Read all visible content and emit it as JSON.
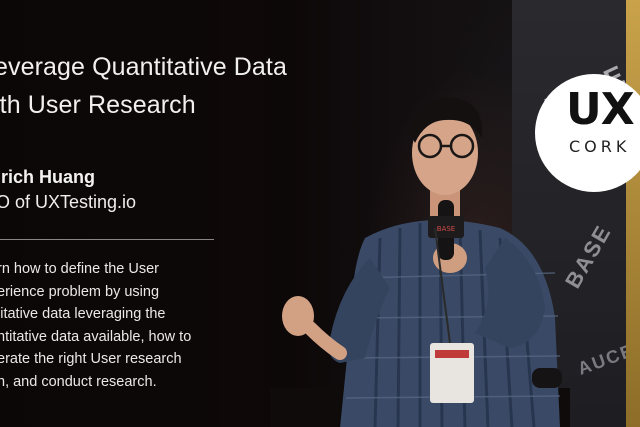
{
  "slide": {
    "title": "everage Quantitative Data\nith User Research",
    "speaker_name": "lrich Huang",
    "speaker_role": "O of UXTesting.io",
    "description": "rn how to define the User\nerience problem by using\nlitative data leveraging the\nntitative data available, how to\nerate the right User research\nn, and conduct research."
  },
  "logo": {
    "main": "UX",
    "sub": "CORK"
  },
  "backdrop": {
    "banner_word": "BASE",
    "banner_word_lower": "AUCE",
    "colors": {
      "background": "#0a0707",
      "text": "#f2f0ef",
      "banner": "#2a2a2e",
      "accent": "#c9a24a",
      "shirt": "#3a4a66"
    }
  }
}
